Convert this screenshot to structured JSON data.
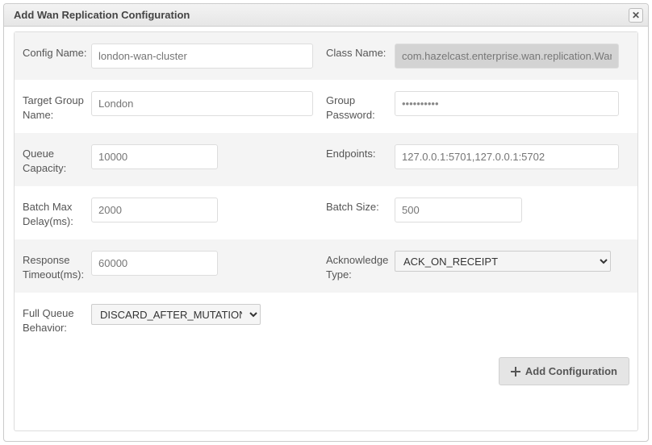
{
  "dialog": {
    "title": "Add Wan Replication Configuration"
  },
  "fields": {
    "config_name": {
      "label": "Config Name:",
      "placeholder": "london-wan-cluster"
    },
    "class_name": {
      "label": "Class Name:",
      "value": "com.hazelcast.enterprise.wan.replication.WanBatchReplication"
    },
    "target_group_name": {
      "label": "Target Group Name:",
      "placeholder": "London"
    },
    "group_password": {
      "label": "Group Password:",
      "value": "••••••••••"
    },
    "queue_capacity": {
      "label": "Queue Capacity:",
      "placeholder": "10000"
    },
    "endpoints": {
      "label": "Endpoints:",
      "placeholder": "127.0.0.1:5701,127.0.0.1:5702"
    },
    "batch_max_delay": {
      "label": "Batch Max Delay(ms):",
      "placeholder": "2000"
    },
    "batch_size": {
      "label": "Batch Size:",
      "placeholder": "500"
    },
    "response_timeout": {
      "label": "Response Timeout(ms):",
      "placeholder": "60000"
    },
    "acknowledge_type": {
      "label": "Acknowledge Type:",
      "selected": "ACK_ON_RECEIPT"
    },
    "full_queue_behavior": {
      "label": "Full Queue Behavior:",
      "selected": "DISCARD_AFTER_MUTATION"
    }
  },
  "buttons": {
    "add_configuration": "Add Configuration"
  }
}
